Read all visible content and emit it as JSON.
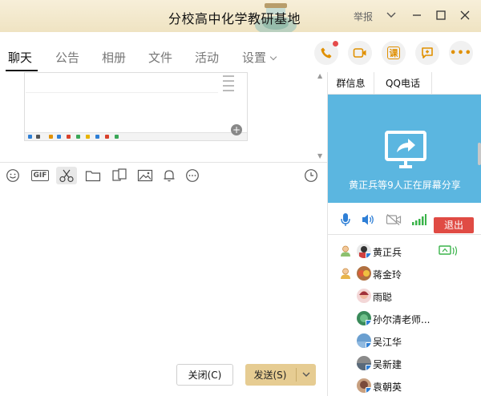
{
  "window": {
    "title": "分校高中化学教研基地",
    "report_label": "举报"
  },
  "tabs": [
    {
      "label": "聊天",
      "active": true
    },
    {
      "label": "公告"
    },
    {
      "label": "相册"
    },
    {
      "label": "文件"
    },
    {
      "label": "活动"
    },
    {
      "label": "设置",
      "has_dropdown": true
    }
  ],
  "actions": {
    "course_label": "课"
  },
  "toolbar": {
    "gif_label": "GIF"
  },
  "buttons": {
    "close_label": "关闭(C)",
    "send_label": "发送(S)"
  },
  "right_panel": {
    "tabs": [
      "群信息",
      "QQ电话"
    ],
    "share_text": "黄正兵等9人正在屏幕分享",
    "quit_label": "退出"
  },
  "members": [
    {
      "name": "黄正兵",
      "role": "owner",
      "sharing": true
    },
    {
      "name": "蒋金玲",
      "role": "admin"
    },
    {
      "name": "雨聪"
    },
    {
      "name": "孙尔清老师..."
    },
    {
      "name": "吴江华"
    },
    {
      "name": "吴新建"
    },
    {
      "name": "袁朝英"
    }
  ],
  "colors": {
    "accent_yellow": "#e6cc92",
    "share_blue": "#5bb6e0",
    "quit_red": "#e04b44",
    "icon_orange": "#e09000"
  }
}
